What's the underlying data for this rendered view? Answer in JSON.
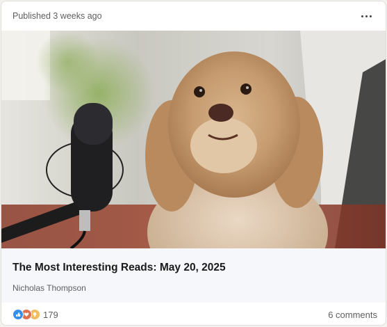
{
  "post": {
    "published": "Published 3 weeks ago",
    "title": "The Most Interesting Reads: May 20, 2025",
    "author": "Nicholas Thompson",
    "reaction_count": "179",
    "comments": "6 comments"
  },
  "icons": {
    "menu": "more-horizontal-icon",
    "reactions": [
      "like-icon",
      "love-icon",
      "insightful-icon"
    ]
  },
  "colors": {
    "like": "#378fe9",
    "love": "#df704d",
    "insightful": "#f5bb5c"
  }
}
